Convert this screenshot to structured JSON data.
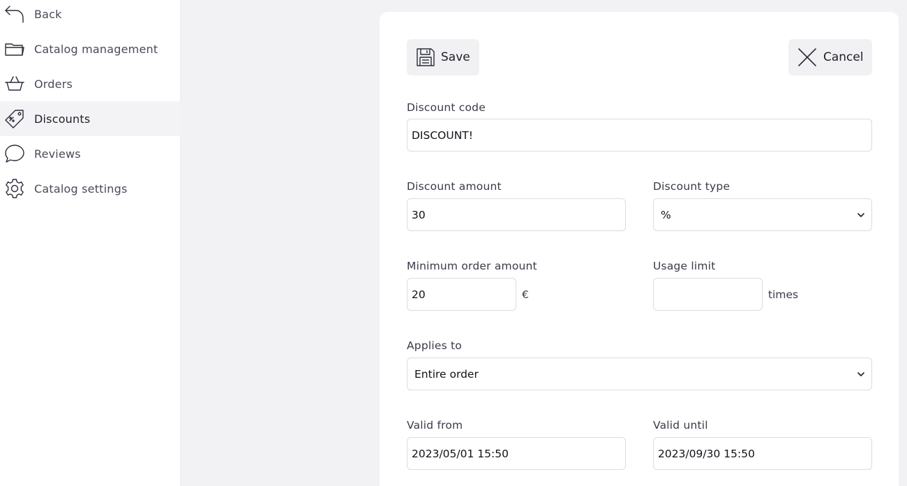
{
  "sidebar": {
    "items": [
      {
        "label": "Back",
        "icon": "back-arrow-icon"
      },
      {
        "label": "Catalog management",
        "icon": "folder-icon"
      },
      {
        "label": "Orders",
        "icon": "basket-icon"
      },
      {
        "label": "Discounts",
        "icon": "price-tag-icon",
        "active": true
      },
      {
        "label": "Reviews",
        "icon": "speech-bubble-icon"
      },
      {
        "label": "Catalog settings",
        "icon": "gear-icon"
      }
    ]
  },
  "toolbar": {
    "save_label": "Save",
    "cancel_label": "Cancel"
  },
  "form": {
    "discount_code": {
      "label": "Discount code",
      "value": "DISCOUNT!"
    },
    "discount_amount": {
      "label": "Discount amount",
      "value": "30"
    },
    "discount_type": {
      "label": "Discount type",
      "value": "%"
    },
    "minimum_order_amount": {
      "label": "Minimum order amount",
      "value": "20",
      "suffix": "€"
    },
    "usage_limit": {
      "label": "Usage limit",
      "value": "",
      "suffix": "times"
    },
    "applies_to": {
      "label": "Applies to",
      "value": "Entire order"
    },
    "valid_from": {
      "label": "Valid from",
      "value": "2023/05/01 15:50"
    },
    "valid_until": {
      "label": "Valid until",
      "value": "2023/09/30 15:50"
    }
  },
  "colors": {
    "page_background": "#f2f2f4",
    "card_background": "#ffffff",
    "button_background": "#f1f1f3",
    "active_nav_background": "#f3f3f5",
    "input_border": "#dcdce2",
    "text": "#1e1e2a"
  }
}
